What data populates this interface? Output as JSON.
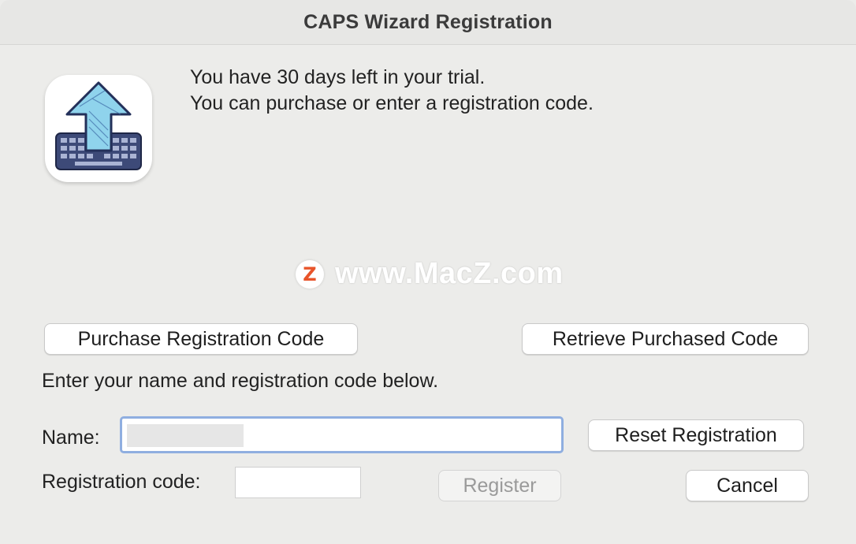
{
  "window": {
    "title": "CAPS Wizard Registration"
  },
  "icon": {
    "name": "caps-wizard-app-icon"
  },
  "message": {
    "line1": "You have 30 days left in your trial.",
    "line2": "You can purchase or enter a registration code."
  },
  "watermark": {
    "logo_letter": "Z",
    "text": "www.MacZ.com"
  },
  "buttons": {
    "purchase": "Purchase Registration Code",
    "retrieve": "Retrieve Purchased Code",
    "reset": "Reset Registration",
    "register": "Register",
    "cancel": "Cancel"
  },
  "form": {
    "instructions": "Enter your name and registration code below.",
    "name_label": "Name:",
    "name_value": "",
    "code_label": "Registration code:",
    "code_value": ""
  },
  "colors": {
    "accent_focus": "#8faee0",
    "icon_arrow": "#8fd3ec",
    "icon_keyboard": "#3d4a78",
    "watermark_logo": "#e8542a"
  }
}
